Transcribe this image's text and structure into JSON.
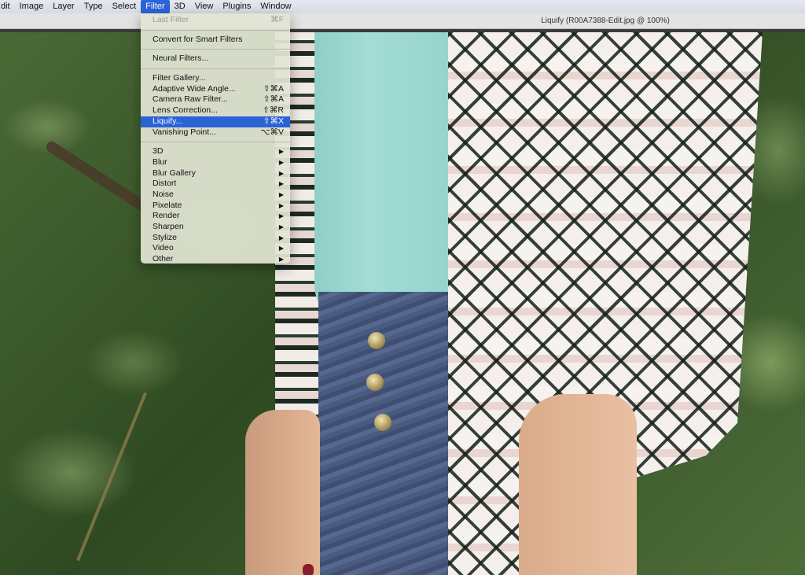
{
  "menubar": {
    "items": [
      "dit",
      "Image",
      "Layer",
      "Type",
      "Select",
      "Filter",
      "3D",
      "View",
      "Plugins",
      "Window"
    ],
    "active": "Filter"
  },
  "window": {
    "title": "Liquify (R00A7388-Edit.jpg @ 100%)"
  },
  "filter_menu": {
    "last_filter": {
      "label": "Last Filter",
      "shortcut": "⌘F"
    },
    "convert": "Convert for Smart Filters",
    "neural": "Neural Filters...",
    "gallery_items": [
      {
        "label": "Filter Gallery...",
        "shortcut": ""
      },
      {
        "label": "Adaptive Wide Angle...",
        "shortcut": "⇧⌘A"
      },
      {
        "label": "Camera Raw Filter...",
        "shortcut": "⇧⌘A"
      },
      {
        "label": "Lens Correction...",
        "shortcut": "⇧⌘R"
      },
      {
        "label": "Liquify...",
        "shortcut": "⇧⌘X"
      },
      {
        "label": "Vanishing Point...",
        "shortcut": "⌥⌘V"
      }
    ],
    "highlighted": "Liquify...",
    "submenus": [
      "3D",
      "Blur",
      "Blur Gallery",
      "Distort",
      "Noise",
      "Pixelate",
      "Render",
      "Sharpen",
      "Stylize",
      "Video",
      "Other"
    ],
    "submenu_arrow": "▶"
  },
  "colors": {
    "accent": "#2a63d6",
    "menu_bg": "#e2e5d4"
  }
}
